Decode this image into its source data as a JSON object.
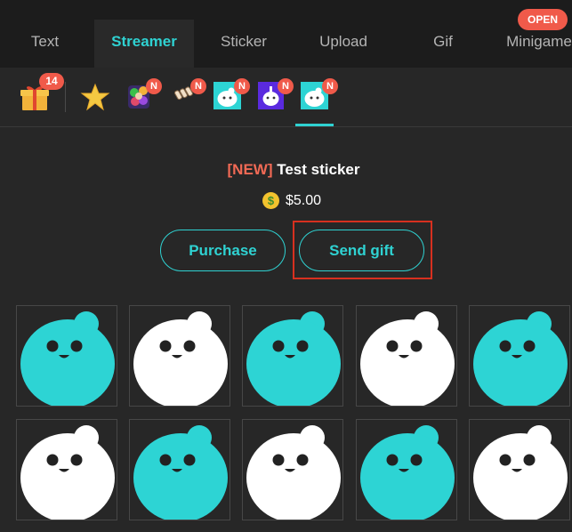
{
  "tabs": [
    {
      "label": "Text",
      "active": false
    },
    {
      "label": "Streamer",
      "active": true
    },
    {
      "label": "Sticker",
      "active": false
    },
    {
      "label": "Upload",
      "active": false
    },
    {
      "label": "Gif",
      "active": false
    },
    {
      "label": "Minigame",
      "active": false
    }
  ],
  "open_badge": "OPEN",
  "strip": {
    "gift_count": "14",
    "new_badge": "N",
    "items": [
      "gift-icon",
      "star-icon",
      "sticker-pack-1",
      "sticker-pack-2",
      "sticker-pack-3",
      "sticker-pack-4",
      "sticker-pack-5"
    ]
  },
  "detail": {
    "new_tag": "[NEW]",
    "title": "Test sticker",
    "coin_symbol": "$",
    "price": "$5.00",
    "purchase_label": "Purchase",
    "send_gift_label": "Send gift"
  },
  "grid": {
    "colors": [
      "#2dd4d4",
      "#ffffff",
      "#2dd4d4",
      "#ffffff",
      "#2dd4d4",
      "#ffffff",
      "#2dd4d4",
      "#ffffff",
      "#2dd4d4",
      "#ffffff"
    ]
  },
  "colors": {
    "accent": "#2fd2d2",
    "badge": "#f05a4a",
    "highlight": "#d7301f"
  }
}
